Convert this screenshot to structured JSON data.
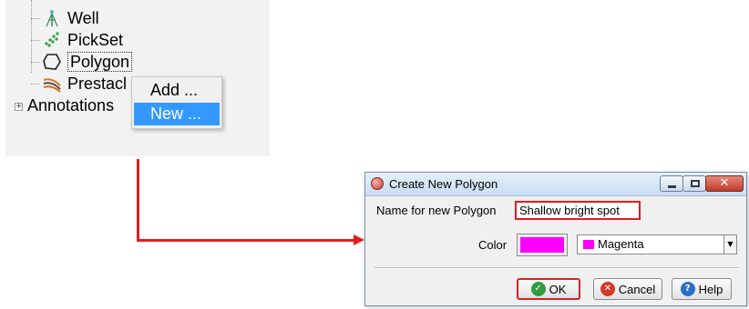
{
  "tree": {
    "items": [
      {
        "label": "Well",
        "icon": "well-icon"
      },
      {
        "label": "PickSet",
        "icon": "pickset-icon"
      },
      {
        "label": "Polygon",
        "icon": "polygon-icon"
      },
      {
        "label": "Prestacl",
        "icon": "prestack-icon"
      }
    ],
    "annotations_label": "Annotations"
  },
  "context_menu": {
    "items": [
      {
        "label": "Add ..."
      },
      {
        "label": "New ..."
      }
    ],
    "highlight_color": "#3399ff"
  },
  "dialog": {
    "title": "Create New Polygon",
    "name_label": "Name for new Polygon",
    "name_value": "Shallow bright spot",
    "color_label": "Color",
    "color_value": "Magenta",
    "color_hex": "#ff00ff",
    "buttons": {
      "ok": "OK",
      "cancel": "Cancel",
      "help": "Help"
    }
  },
  "colors": {
    "highlight_red": "#e01e1e",
    "ok_green": "#2e9e3e",
    "cancel_red": "#d23a2a",
    "help_blue": "#2b6fc7"
  }
}
